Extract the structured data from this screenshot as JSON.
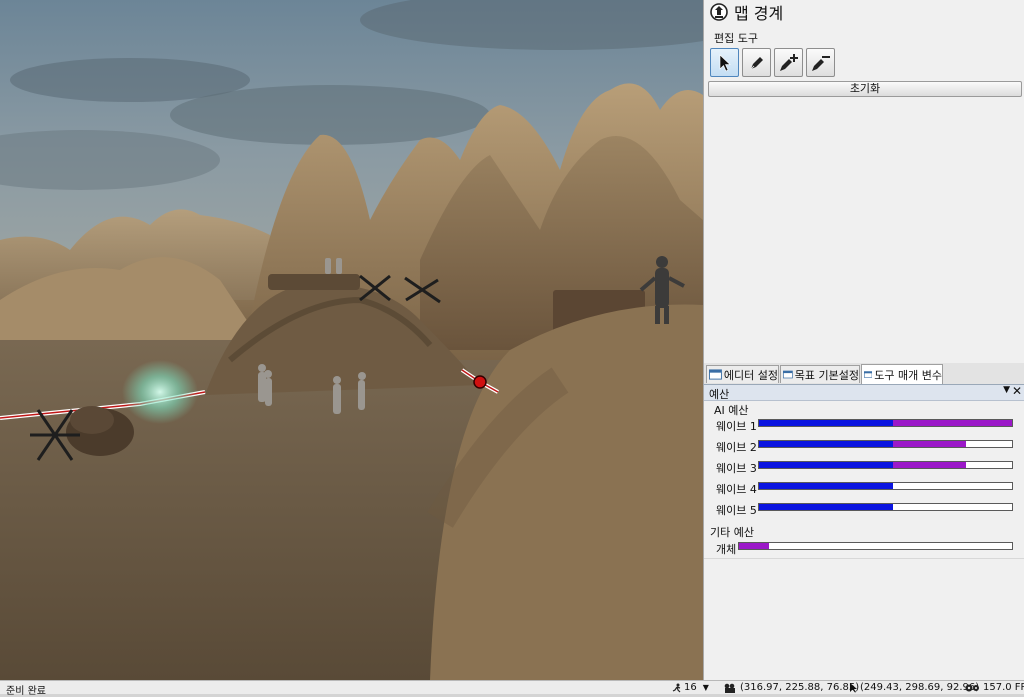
{
  "panel": {
    "title": "맵 경계",
    "tools_label": "편집 도구",
    "tools": [
      {
        "name": "select-tool",
        "icon": "cursor-arrow-icon",
        "active": true
      },
      {
        "name": "pen-tool",
        "icon": "pen-icon",
        "active": false
      },
      {
        "name": "pen-add-tool",
        "icon": "pen-add-icon",
        "active": false
      },
      {
        "name": "pen-remove-tool",
        "icon": "pen-remove-icon",
        "active": false
      }
    ],
    "reset_label": "초기화"
  },
  "tabs": [
    {
      "label": "에디터 설정",
      "active": false
    },
    {
      "label": "목표 기본설정",
      "active": false
    },
    {
      "label": "도구 매개 변수",
      "active": true
    }
  ],
  "budget": {
    "header": "예산",
    "ai_group": "AI 예산",
    "waves": [
      {
        "label": "웨이브 1",
        "blue": 0.53,
        "purple": 0.47
      },
      {
        "label": "웨이브 2",
        "blue": 0.53,
        "purple": 0.29
      },
      {
        "label": "웨이브 3",
        "blue": 0.53,
        "purple": 0.29
      },
      {
        "label": "웨이브 4",
        "blue": 0.53,
        "purple": 0.0
      },
      {
        "label": "웨이브 5",
        "blue": 0.53,
        "purple": 0.0
      }
    ],
    "other_group": "기타 예산",
    "other": [
      {
        "label": "개체",
        "blue": 0.0,
        "purple": 0.11
      }
    ],
    "colors": {
      "blue": "#0a14e0",
      "purple": "#9b18c8"
    }
  },
  "status": {
    "left": "준비 완료",
    "count": "16",
    "camera_pos": "(316.97, 225.88, 76.85)",
    "cursor_pos": "(249.43, 298.69, 92.96)",
    "fps": "157.0 FPS"
  }
}
